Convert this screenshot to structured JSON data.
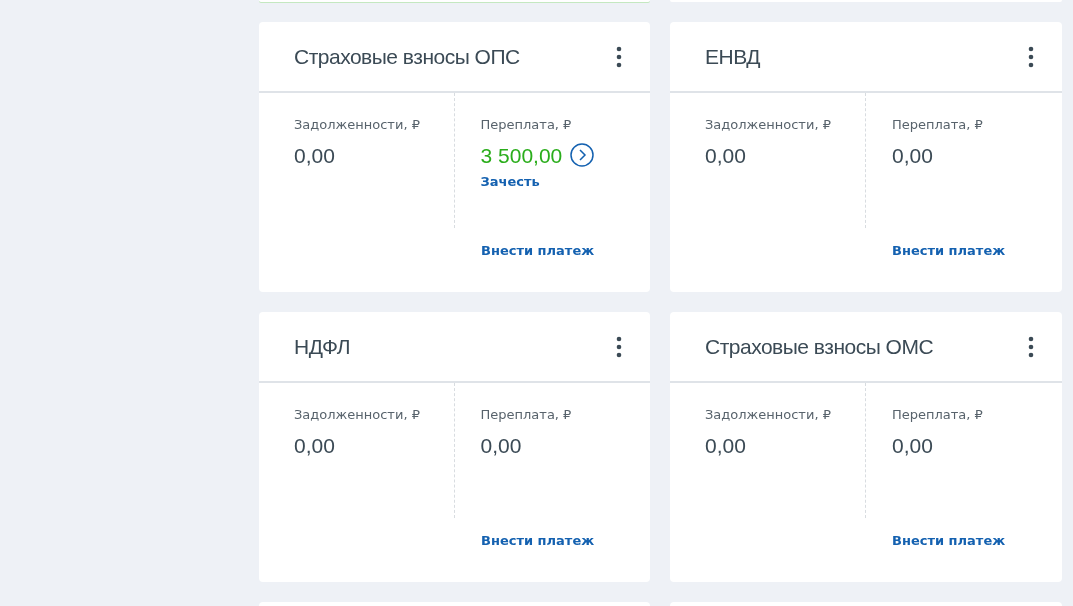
{
  "cards": [
    {
      "title": "Страховые взносы ОПС",
      "debt": {
        "label": "Задолженности, ₽",
        "value": "0,00"
      },
      "overpayment": {
        "label": "Переплата, ₽",
        "value": "3 500,00",
        "kind": "credit",
        "action": "Зачесть"
      },
      "pay_link": "Внести платеж"
    },
    {
      "title": "ЕНВД",
      "debt": {
        "label": "Задолженности, ₽",
        "value": "0,00"
      },
      "overpayment": {
        "label": "Переплата, ₽",
        "value": "0,00",
        "kind": "plain"
      },
      "pay_link": "Внести платеж"
    },
    {
      "title": "НДФЛ",
      "debt": {
        "label": "Задолженности, ₽",
        "value": "0,00"
      },
      "overpayment": {
        "label": "Переплата, ₽",
        "value": "0,00",
        "kind": "plain"
      },
      "pay_link": "Внести платеж"
    },
    {
      "title": "Страховые взносы ОМС",
      "debt": {
        "label": "Задолженности, ₽",
        "value": "0,00"
      },
      "overpayment": {
        "label": "Переплата, ₽",
        "value": "0,00",
        "kind": "plain"
      },
      "pay_link": "Внести платеж"
    }
  ]
}
